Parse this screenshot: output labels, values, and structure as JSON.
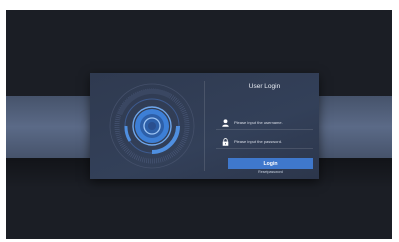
{
  "login": {
    "title": "User Login",
    "username_placeholder": "Please input the username.",
    "password_placeholder": "Please input the password.",
    "login_label": "Login",
    "reset_label": "Resetpassword"
  },
  "colors": {
    "background": "#1b1e25",
    "band": "#5b6a87",
    "panel": "#334059",
    "accent": "#3f78cc",
    "text": "#e8ecf3"
  }
}
